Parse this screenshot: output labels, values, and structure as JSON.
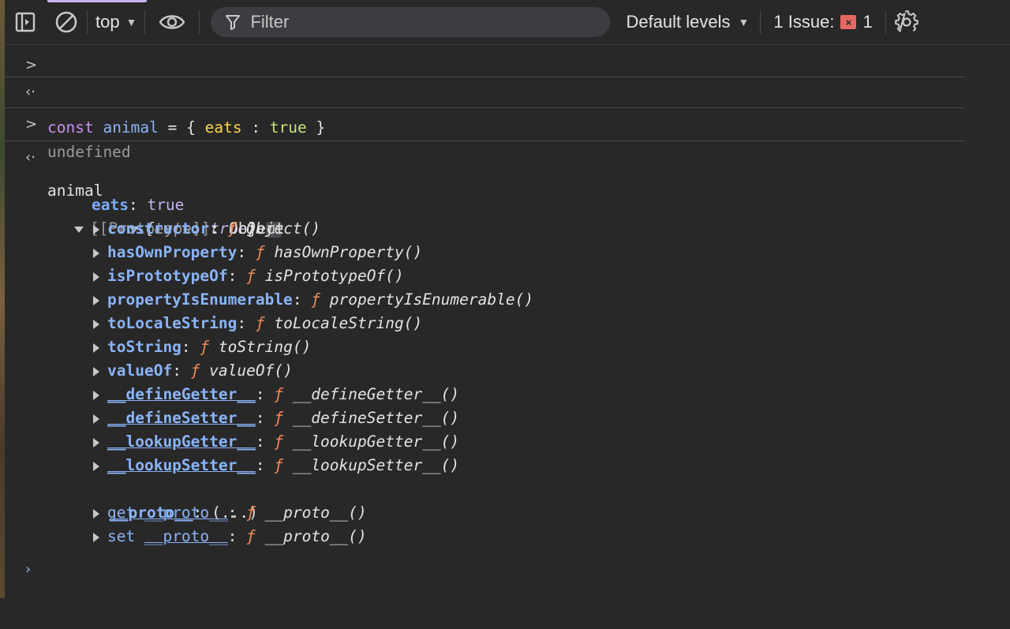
{
  "toolbar": {
    "context": "top",
    "filter_placeholder": "Filter",
    "levels": "Default levels",
    "issues_label": "1 Issue:",
    "issues_count": "1"
  },
  "console": {
    "input1": {
      "kw": "const",
      "var": "animal",
      "eq": " = { ",
      "prop": "eats",
      "colon": " : ",
      "val": "true",
      "close": " }"
    },
    "result1": "undefined",
    "input2": "animal",
    "object_preview": {
      "open": "{",
      "key": "eats",
      "sep": ": ",
      "val": "true",
      "close": "}"
    },
    "info_badge": "i",
    "own_prop": {
      "key": "eats",
      "val": "true"
    },
    "prototype_label": "[[Prototype]]",
    "prototype_value": "Object",
    "proto_members": [
      {
        "key": "constructor",
        "fn": "Object()"
      },
      {
        "key": "hasOwnProperty",
        "fn": "hasOwnProperty()"
      },
      {
        "key": "isPrototypeOf",
        "fn": "isPrototypeOf()"
      },
      {
        "key": "propertyIsEnumerable",
        "fn": "propertyIsEnumerable()"
      },
      {
        "key": "toLocaleString",
        "fn": "toLocaleString()"
      },
      {
        "key": "toString",
        "fn": "toString()"
      },
      {
        "key": "valueOf",
        "fn": "valueOf()"
      },
      {
        "key": "__defineGetter__",
        "fn": "__defineGetter__()"
      },
      {
        "key": "__defineSetter__",
        "fn": "__defineSetter__()"
      },
      {
        "key": "__lookupGetter__",
        "fn": "__lookupGetter__()"
      },
      {
        "key": "__lookupSetter__",
        "fn": "__lookupSetter__()"
      }
    ],
    "proto_getter": {
      "key": "__proto__",
      "val": "(...)"
    },
    "accessors": [
      {
        "prefix": "get ",
        "key": "__proto__",
        "fn": "__proto__()"
      },
      {
        "prefix": "set ",
        "key": "__proto__",
        "fn": "__proto__()"
      }
    ],
    "f_symbol": "ƒ"
  }
}
